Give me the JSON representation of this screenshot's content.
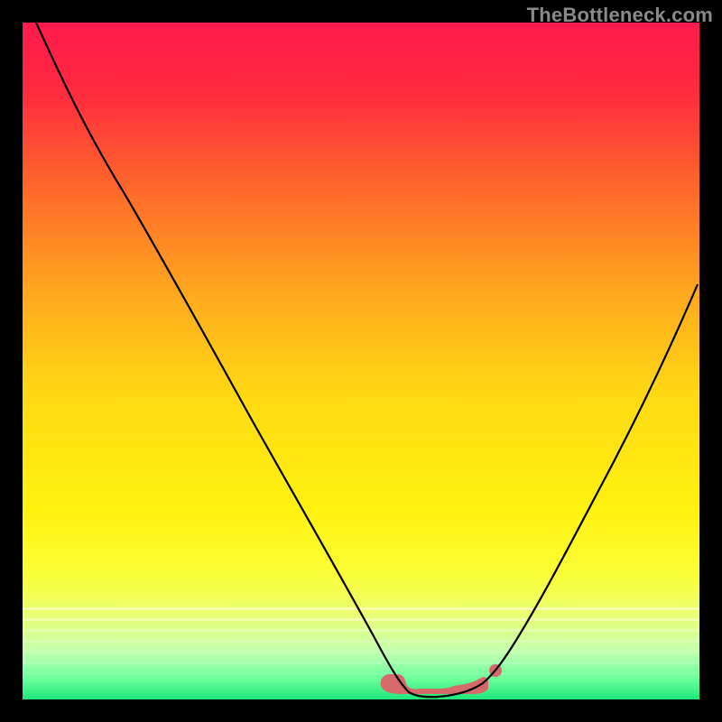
{
  "watermark": "TheBottleneck.com",
  "colors": {
    "curve_stroke": "#000000",
    "emphasis": "#d66a6a",
    "frame": "#000000"
  },
  "chart_data": {
    "type": "line",
    "title": "",
    "xlabel": "",
    "ylabel": "",
    "xlim": [
      0,
      100
    ],
    "ylim": [
      0,
      100
    ],
    "background_gradient": {
      "type": "vertical-rainbow",
      "stops": [
        {
          "pos": 0.0,
          "color": "#ff1a4d"
        },
        {
          "pos": 0.1,
          "color": "#ff2a3f"
        },
        {
          "pos": 0.25,
          "color": "#ff6a2a"
        },
        {
          "pos": 0.4,
          "color": "#ffa81e"
        },
        {
          "pos": 0.55,
          "color": "#ffd914"
        },
        {
          "pos": 0.72,
          "color": "#fff20f"
        },
        {
          "pos": 0.82,
          "color": "#faff3a"
        },
        {
          "pos": 0.88,
          "color": "#e8ff7a"
        },
        {
          "pos": 0.93,
          "color": "#c2ffb0"
        },
        {
          "pos": 0.97,
          "color": "#6aff9a"
        },
        {
          "pos": 1.0,
          "color": "#1ee87a"
        }
      ]
    },
    "series": [
      {
        "name": "bottleneck-curve",
        "description": "V-shaped curve dipping to zero at the valley then rising again",
        "x": [
          2,
          5,
          10,
          15,
          20,
          25,
          30,
          35,
          40,
          45,
          50,
          53,
          55,
          57,
          60,
          63,
          65,
          67,
          70,
          75,
          80,
          85,
          90,
          95,
          100
        ],
        "y": [
          100,
          94,
          85,
          75,
          66,
          57,
          48,
          39,
          30,
          21,
          12,
          6,
          2,
          0,
          0,
          0,
          0,
          1,
          4,
          12,
          22,
          33,
          45,
          55,
          62
        ]
      }
    ],
    "emphasis_region": {
      "description": "Salmon rounded band along the valley floor",
      "x_start": 53,
      "x_end": 68,
      "y": 0
    },
    "emphasis_dot": {
      "x": 70,
      "y": 3
    }
  }
}
